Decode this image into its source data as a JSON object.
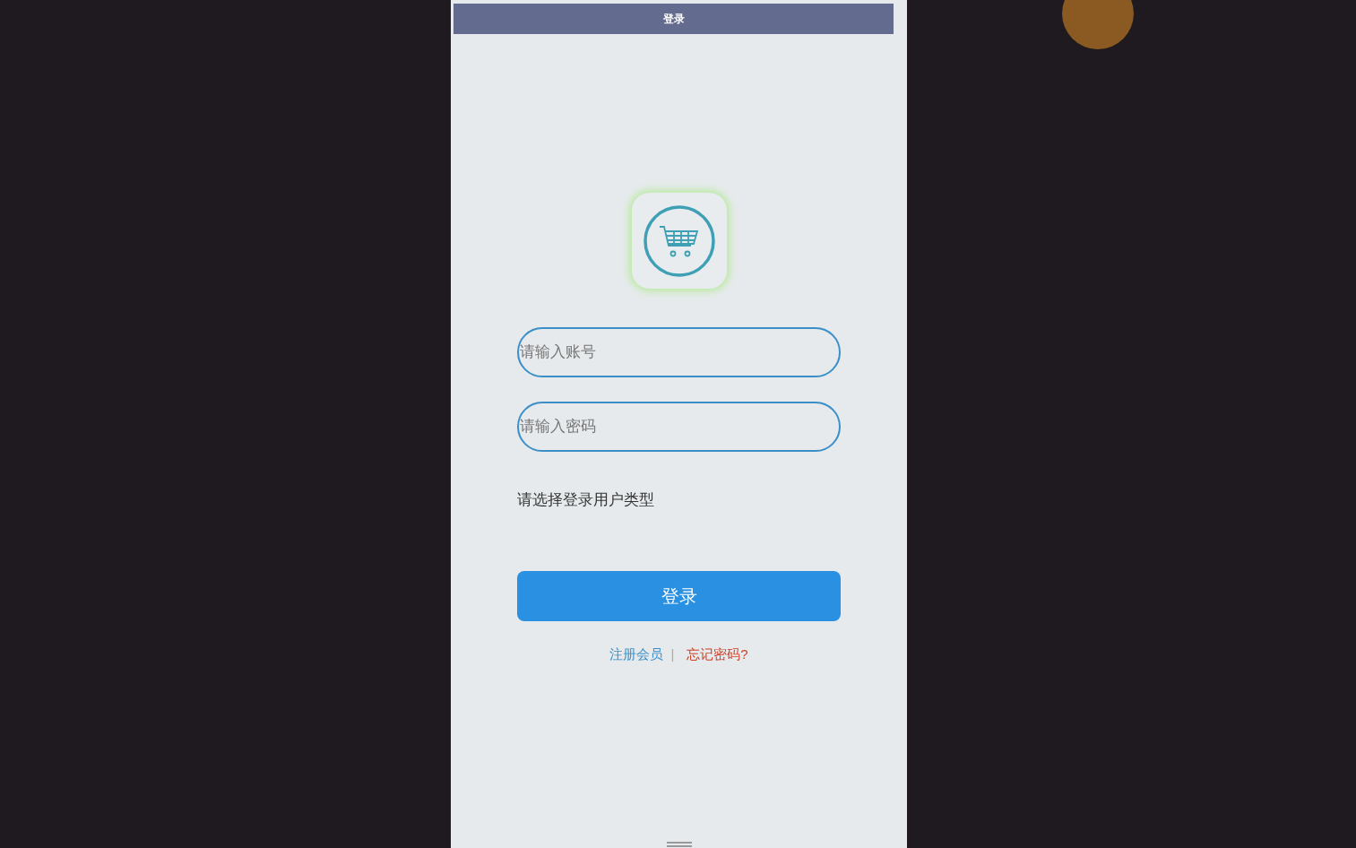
{
  "header": {
    "title": "登录"
  },
  "fields": [
    {
      "placeholder": "请输入账号"
    },
    {
      "placeholder": "请输入密码"
    }
  ],
  "user_type_label": "请选择登录用户类型",
  "login_button": "登录",
  "links": [
    {
      "label": "注册会员",
      "color": "#3a8fc8"
    },
    {
      "label": "忘记密码?",
      "color": "#d0432a"
    }
  ],
  "link_separator": "|"
}
